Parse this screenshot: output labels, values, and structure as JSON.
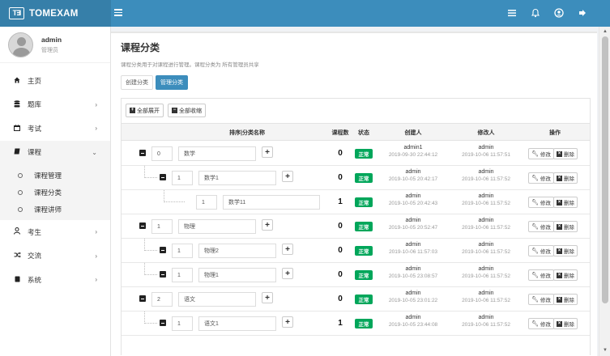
{
  "app": {
    "name": "TOMEXAM",
    "logo_text": "T∃",
    "accent_color": "#3c8dbc",
    "brand_color": "#367fa9"
  },
  "user": {
    "name": "admin",
    "role": "管理员"
  },
  "sidebar": {
    "items": [
      {
        "label": "主页",
        "icon": "home-icon"
      },
      {
        "label": "题库",
        "icon": "database-icon"
      },
      {
        "label": "考试",
        "icon": "calendar-icon"
      },
      {
        "label": "课程",
        "icon": "book-icon",
        "expanded": true,
        "children": [
          {
            "label": "课程管理"
          },
          {
            "label": "课程分类"
          },
          {
            "label": "课程讲师"
          }
        ]
      },
      {
        "label": "考生",
        "icon": "user-icon"
      },
      {
        "label": "交流",
        "icon": "random-icon"
      },
      {
        "label": "系统",
        "icon": "file-icon"
      }
    ]
  },
  "page": {
    "title": "课程分类",
    "description": "课程分类用于对课程进行管理。课程分类为 所有管理员共享",
    "tabs": [
      {
        "label": "创建分类",
        "active": false
      },
      {
        "label": "管理分类",
        "active": true
      }
    ]
  },
  "toolbar": {
    "expand_label": "全部展开",
    "collapse_label": "全部收缩"
  },
  "table": {
    "headers": {
      "sort_name": "排序|分类名称",
      "count": "课程数",
      "status": "状态",
      "creator": "创建人",
      "modifier": "修改人",
      "ops": "操作"
    },
    "edit_label": "修改",
    "delete_label": "删除",
    "status_color": "#00a65a",
    "rows": [
      {
        "level": 0,
        "sort": "0",
        "name": "数学",
        "count": "0",
        "status": "正常",
        "creator": "admin1",
        "created": "2019-09-30 22:44:12",
        "modifier": "admin",
        "modified": "2019-10-06 11:57:51",
        "has_toggle": true
      },
      {
        "level": 1,
        "sort": "1",
        "name": "数学1",
        "count": "0",
        "status": "正常",
        "creator": "admin",
        "created": "2019-10-05 20:42:17",
        "modifier": "admin",
        "modified": "2019-10-06 11:57:52",
        "has_toggle": true
      },
      {
        "level": 2,
        "sort": "1",
        "name": "数学11",
        "count": "1",
        "status": "正常",
        "creator": "admin",
        "created": "2019-10-05 20:42:43",
        "modifier": "admin",
        "modified": "2019-10-06 11:57:52",
        "has_toggle": false
      },
      {
        "level": 0,
        "sort": "1",
        "name": "物理",
        "count": "0",
        "status": "正常",
        "creator": "admin",
        "created": "2019-10-05 20:52:47",
        "modifier": "admin",
        "modified": "2019-10-06 11:57:52",
        "has_toggle": true
      },
      {
        "level": 1,
        "sort": "1",
        "name": "物理2",
        "count": "0",
        "status": "正常",
        "creator": "admin",
        "created": "2019-10-06 11:57:03",
        "modifier": "admin",
        "modified": "2019-10-06 11:57:52",
        "has_toggle": true
      },
      {
        "level": 1,
        "sort": "1",
        "name": "物理1",
        "count": "0",
        "status": "正常",
        "creator": "admin",
        "created": "2019-10-05 23:08:57",
        "modifier": "admin",
        "modified": "2019-10-06 11:57:52",
        "has_toggle": true
      },
      {
        "level": 0,
        "sort": "2",
        "name": "语文",
        "count": "0",
        "status": "正常",
        "creator": "admin",
        "created": "2019-10-05 23:01:22",
        "modifier": "admin",
        "modified": "2019-10-06 11:57:52",
        "has_toggle": true
      },
      {
        "level": 1,
        "sort": "1",
        "name": "语文1",
        "count": "1",
        "status": "正常",
        "creator": "admin",
        "created": "2019-10-05 23:44:08",
        "modifier": "admin",
        "modified": "2019-10-06 11:57:52",
        "has_toggle": true
      }
    ]
  }
}
